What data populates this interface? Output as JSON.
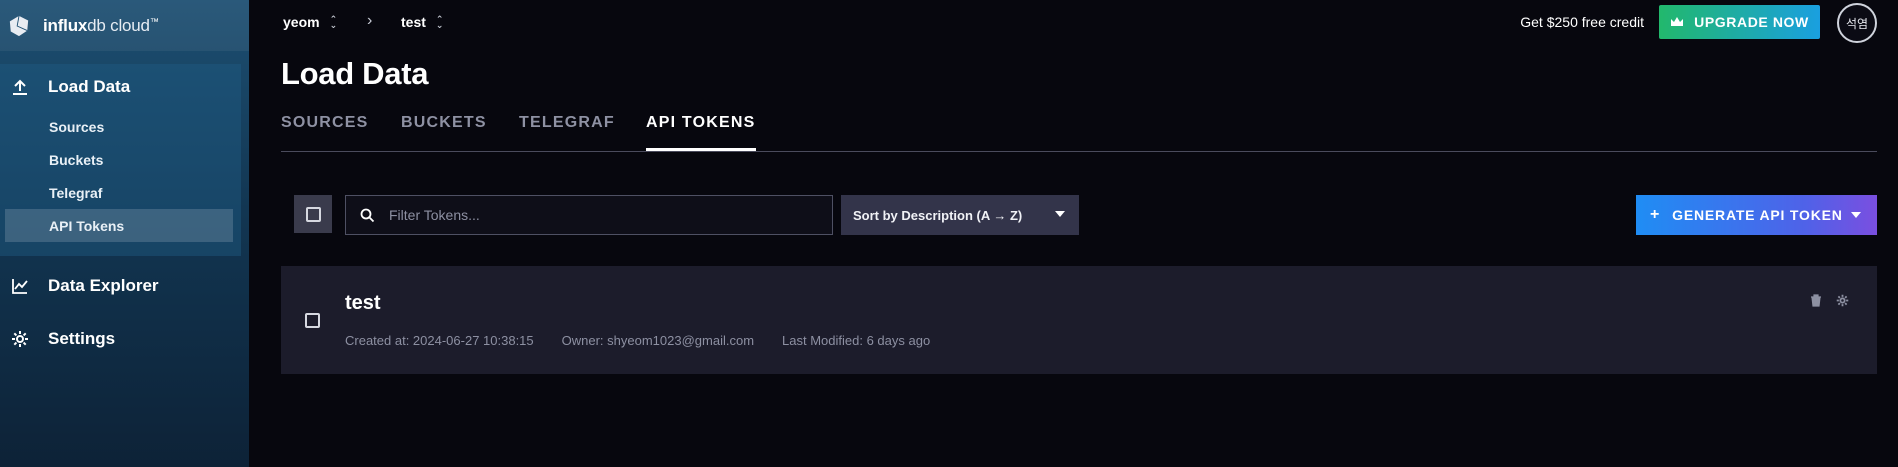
{
  "brand": {
    "bold": "influx",
    "thin": "db cloud",
    "tm": "™"
  },
  "sidebar": {
    "load_data": {
      "label": "Load Data",
      "icon": "upload-icon"
    },
    "sub_items": [
      {
        "label": "Sources"
      },
      {
        "label": "Buckets"
      },
      {
        "label": "Telegraf"
      },
      {
        "label": "API Tokens",
        "active": true
      }
    ],
    "data_explorer": {
      "label": "Data Explorer",
      "icon": "chart-line-icon"
    },
    "settings": {
      "label": "Settings",
      "icon": "gear-icon"
    }
  },
  "topbar": {
    "org": "yeom",
    "bucket": "test",
    "credit": "Get $250 free credit",
    "upgrade_label": "UPGRADE NOW",
    "avatar_text": "석염"
  },
  "page": {
    "title": "Load Data",
    "tabs": [
      {
        "label": "SOURCES"
      },
      {
        "label": "BUCKETS"
      },
      {
        "label": "TELEGRAF"
      },
      {
        "label": "API TOKENS",
        "active": true
      }
    ]
  },
  "toolbar": {
    "search_placeholder": "Filter Tokens...",
    "sort_label": "Sort by Description (A → Z)",
    "generate_label": "GENERATE API TOKEN"
  },
  "tokens": [
    {
      "name": "test",
      "created": "Created at: 2024-06-27 10:38:15",
      "owner": "Owner: shyeom1023@gmail.com",
      "modified": "Last Modified: 6 days ago"
    }
  ],
  "colors": {
    "background": "#07070e",
    "card": "#1c1c2b",
    "upgrade_gradient": [
      "#22b86c",
      "#1a9fe0"
    ],
    "generate_gradient": [
      "#1f8df4",
      "#7a4fe0"
    ]
  }
}
